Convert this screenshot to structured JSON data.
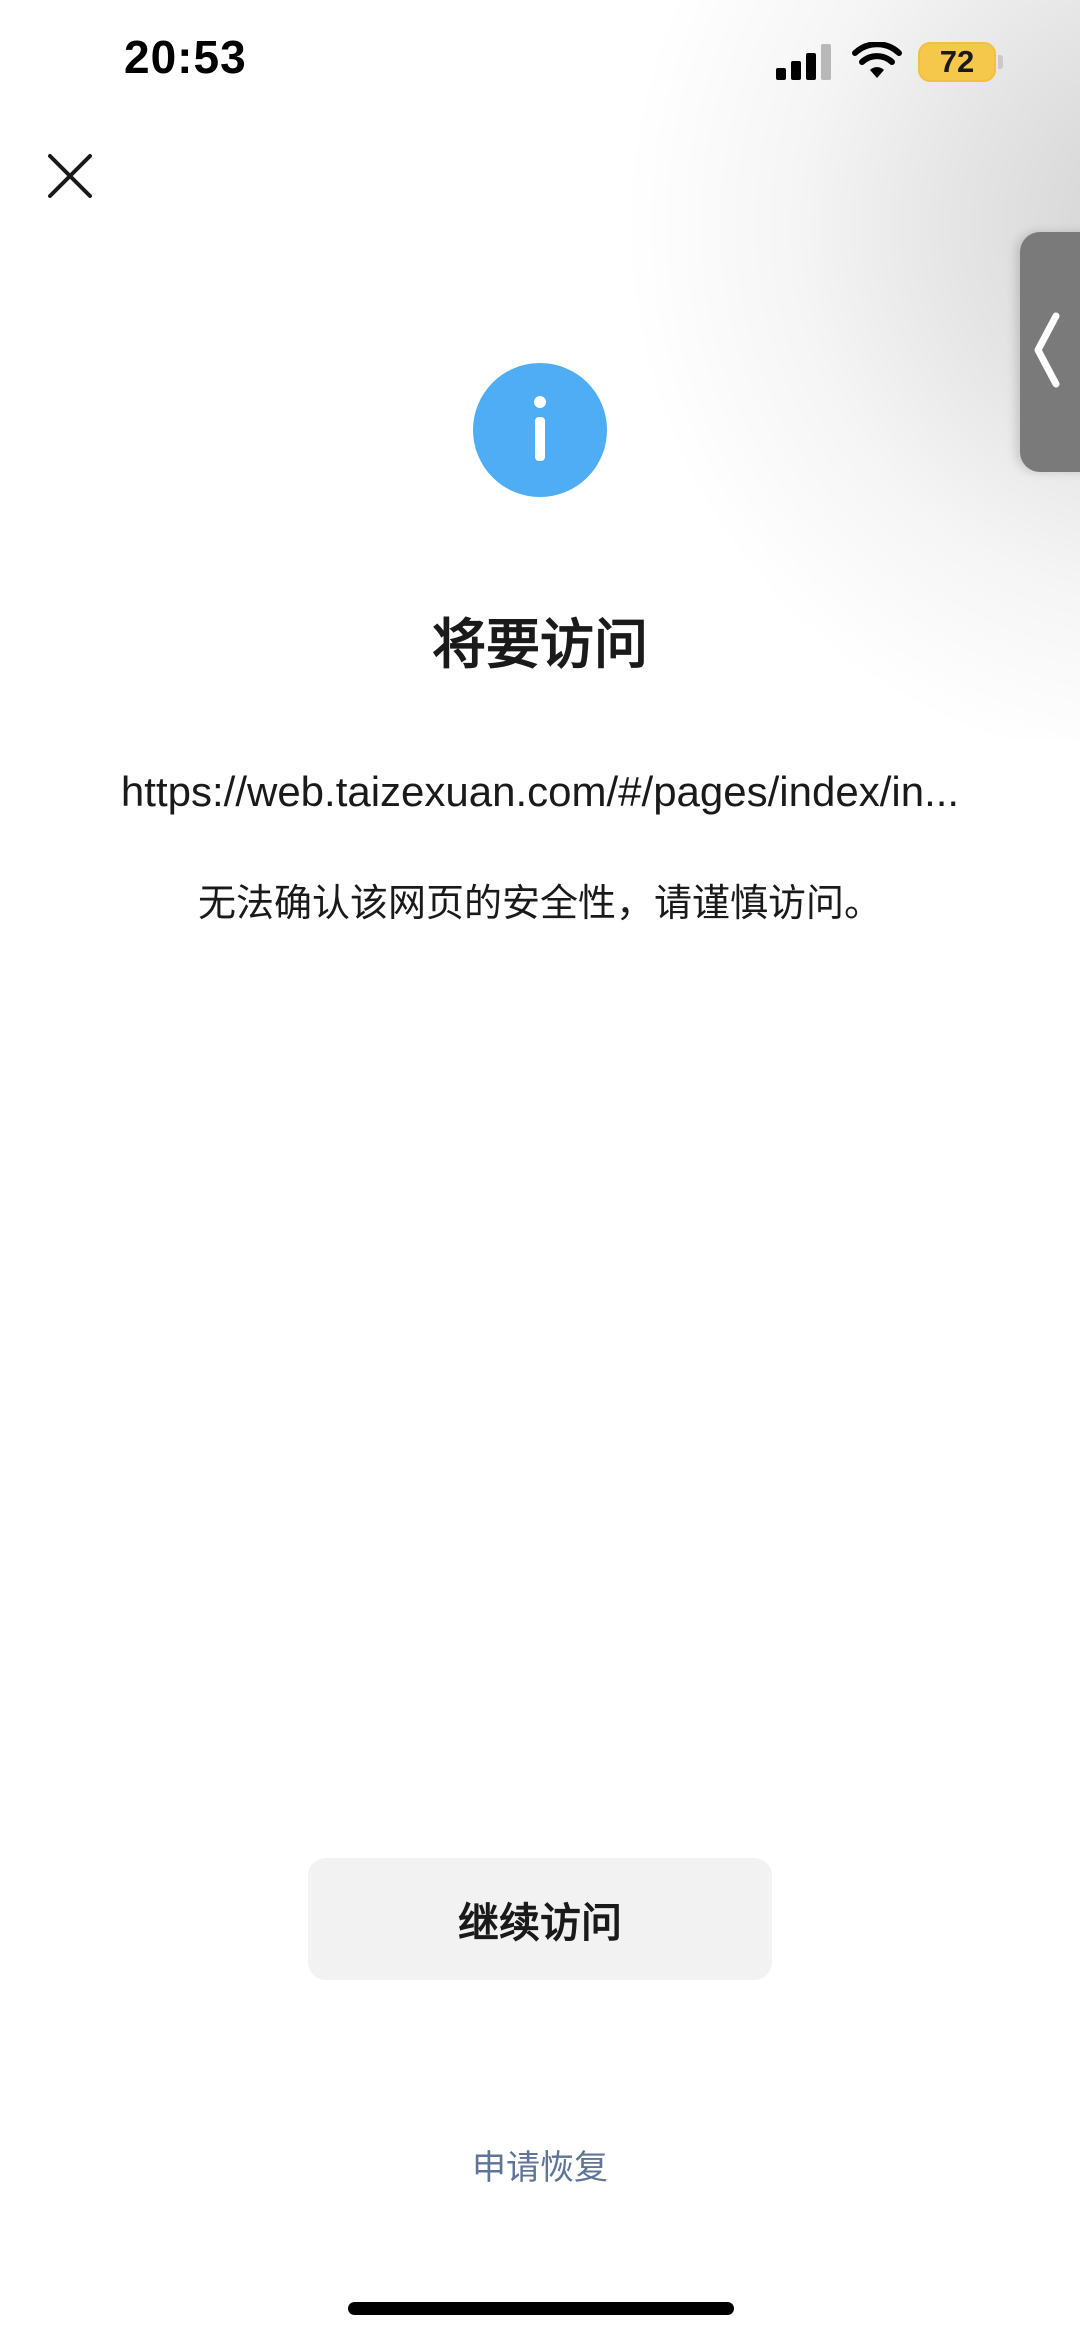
{
  "status_bar": {
    "time": "20:53",
    "battery_level": "72",
    "signal_icon": "cellular-signal-icon",
    "wifi_icon": "wifi-icon",
    "battery_color": "#f5c84b"
  },
  "header": {
    "close_icon": "close-icon"
  },
  "side_handle": {
    "icon": "chevron-left-icon"
  },
  "notice": {
    "icon": "info-icon",
    "icon_color": "#4eadf5",
    "title": "将要访问",
    "url": "https://web.taizexuan.com/#/pages/index/in...",
    "warning": "无法确认该网页的安全性，请谨慎访问。"
  },
  "actions": {
    "continue_label": "继续访问",
    "restore_label": "申请恢复",
    "restore_color": "#5f7496"
  }
}
